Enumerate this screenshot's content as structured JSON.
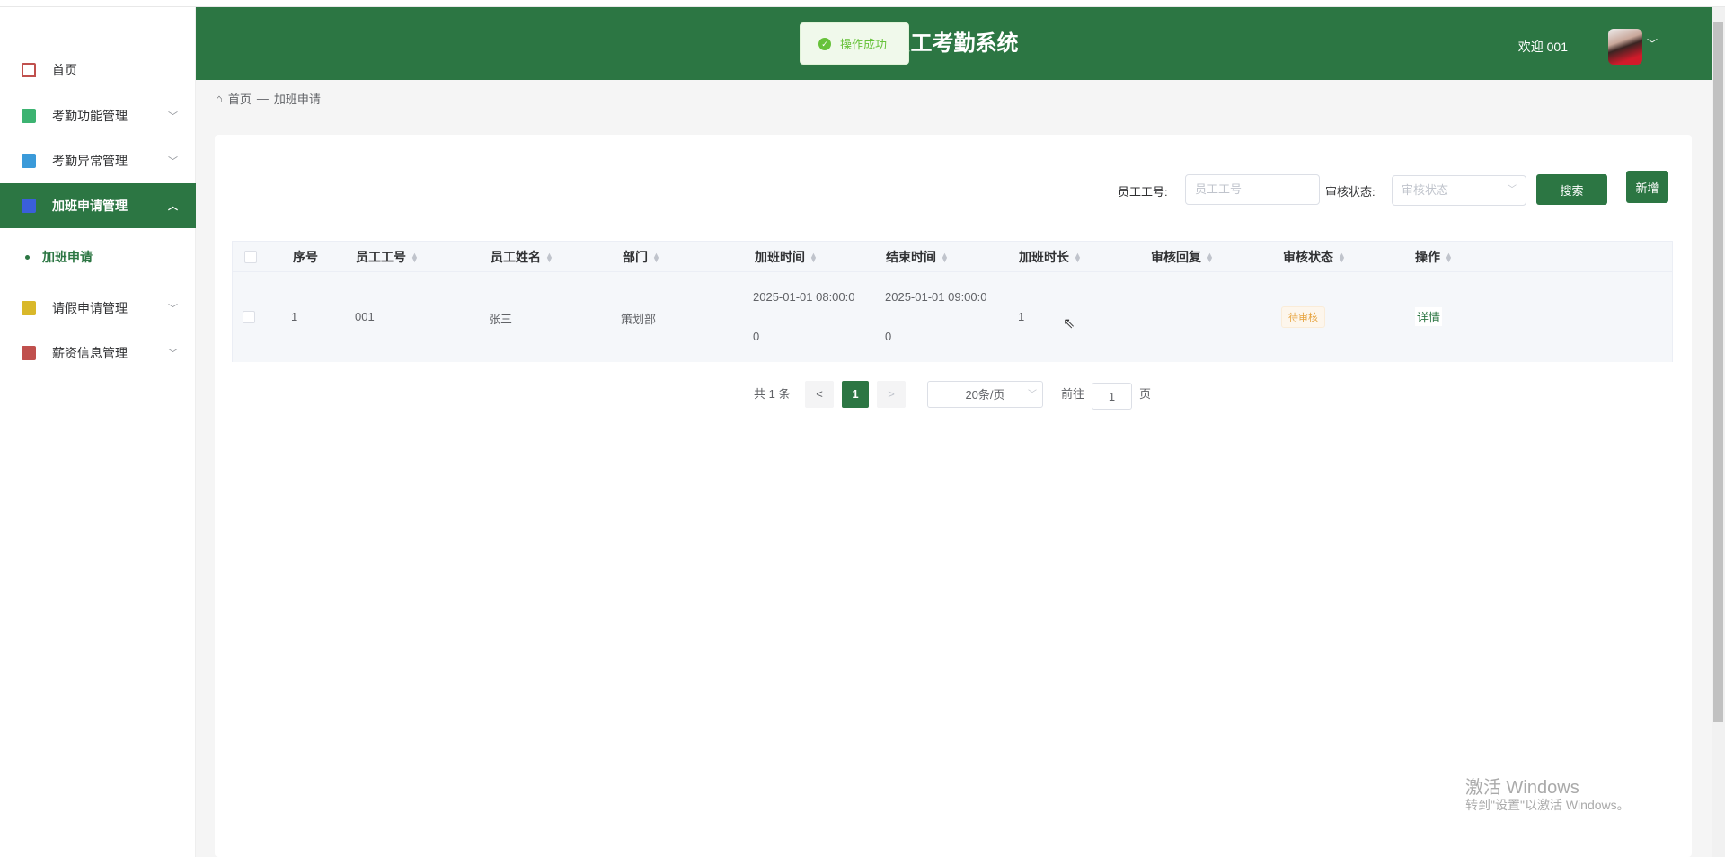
{
  "header": {
    "title": "员工考勤系统",
    "welcome": "欢迎 001"
  },
  "toast": {
    "message": "操作成功",
    "type": "success"
  },
  "sidebar": {
    "items": [
      {
        "label": "首页",
        "icon": "home-icon",
        "color": "#c0504d"
      },
      {
        "label": "考勤功能管理",
        "icon": "crop-icon",
        "color": "#3cb371"
      },
      {
        "label": "考勤异常管理",
        "icon": "book-icon",
        "color": "#3a9ad9"
      },
      {
        "label": "加班申请管理",
        "icon": "layers-icon",
        "color": "#3a5fd9",
        "active": true
      },
      {
        "label": "加班申请",
        "sub": true
      },
      {
        "label": "请假申请管理",
        "icon": "bookmark-icon",
        "color": "#d9b82a"
      },
      {
        "label": "薪资信息管理",
        "icon": "layout-icon",
        "color": "#c0504d"
      }
    ]
  },
  "breadcrumb": [
    "首页",
    "—",
    "加班申请"
  ],
  "search": {
    "emp_label": "员工工号:",
    "emp_placeholder": "员工工号",
    "status_label": "审核状态:",
    "status_placeholder": "审核状态",
    "search_btn": "搜索",
    "add_btn": "新增"
  },
  "table": {
    "columns": [
      "序号",
      "员工工号",
      "员工姓名",
      "部门",
      "加班时间",
      "结束时间",
      "加班时长",
      "审核回复",
      "审核状态",
      "操作"
    ],
    "rows": [
      {
        "index": "1",
        "emp_no": "001",
        "name": "张三",
        "dept": "策划部",
        "start_a": "2025-01-01 08:00:0",
        "start_b": "0",
        "end_a": "2025-01-01 09:00:0",
        "end_b": "0",
        "hours": "1",
        "reply": "",
        "status": "待审核",
        "action": "详情"
      }
    ]
  },
  "pagination": {
    "total": "共 1 条",
    "prev": "<",
    "page": "1",
    "next": ">",
    "page_size": "20条/页",
    "goto": "前往",
    "goto_value": "1",
    "page_unit": "页"
  },
  "watermark": {
    "line1": "激活 Windows",
    "line2": "转到\"设置\"以激活 Windows。"
  },
  "colors": {
    "primary": "#2c7643",
    "warning": "#e6a23c",
    "success": "#67c23a"
  }
}
